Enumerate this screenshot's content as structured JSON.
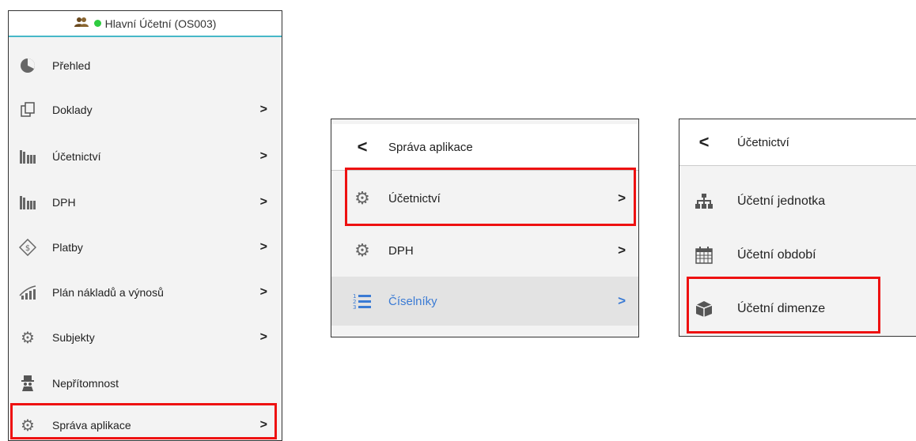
{
  "panel1": {
    "header": "Hlavní Účetní (OS003)",
    "items": [
      {
        "label": "Přehled",
        "icon": "pie-chart-icon",
        "chevron": false
      },
      {
        "label": "Doklady",
        "icon": "documents-icon",
        "chevron": true
      },
      {
        "label": "Účetnictví",
        "icon": "books-icon",
        "chevron": true
      },
      {
        "label": "DPH",
        "icon": "books-icon",
        "chevron": true
      },
      {
        "label": "Platby",
        "icon": "payment-icon",
        "chevron": true
      },
      {
        "label": "Plán nákladů a výnosů",
        "icon": "trend-chart-icon",
        "chevron": true
      },
      {
        "label": "Subjekty",
        "icon": "gear-icon",
        "chevron": true
      },
      {
        "label": "Nepřítomnost",
        "icon": "incognito-icon",
        "chevron": false
      },
      {
        "label": "Správa aplikace",
        "icon": "gear-icon",
        "chevron": true
      }
    ],
    "chevron": ">"
  },
  "panel2": {
    "back_title": "Správa aplikace",
    "items": [
      {
        "label": "Účetnictví",
        "icon": "gear-icon"
      },
      {
        "label": "DPH",
        "icon": "gear-icon"
      },
      {
        "label": "Číselníky",
        "icon": "numbered-list-icon",
        "active": true
      }
    ],
    "chevron": ">"
  },
  "panel3": {
    "back_title": "Účetnictví",
    "items": [
      {
        "label": "Účetní jednotka",
        "icon": "sitemap-icon"
      },
      {
        "label": "Účetní období",
        "icon": "calendar-icon"
      },
      {
        "label": "Účetní dimenze",
        "icon": "cube-icon"
      }
    ]
  },
  "colors": {
    "highlight": "#e11111",
    "accent": "#46b8c8",
    "active_link": "#3b7bd4"
  }
}
